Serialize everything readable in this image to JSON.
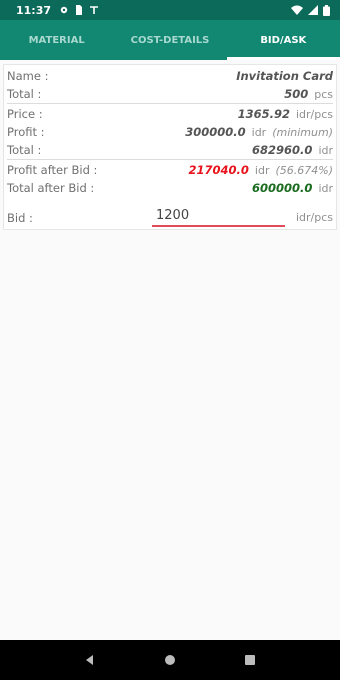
{
  "status": {
    "time": "11:37",
    "left_icons": [
      "gear-icon",
      "sim-card-icon",
      "signal-settings-icon"
    ],
    "right_icons": [
      "wifi-icon",
      "cell-signal-icon",
      "battery-icon"
    ]
  },
  "tabs": [
    {
      "label": "MATERIAL",
      "active": false
    },
    {
      "label": "COST-DETAILS",
      "active": false
    },
    {
      "label": "BID/ASK",
      "active": true
    }
  ],
  "details": {
    "name_label": "Name :",
    "name_value": "Invitation Card",
    "total_label": "Total :",
    "total_value": "500",
    "total_unit": "pcs",
    "price_label": "Price :",
    "price_value": "1365.92",
    "price_unit": "idr/pcs",
    "profit_label": "Profit :",
    "profit_value": "300000.0",
    "profit_unit": "idr",
    "profit_note": "(minimum)",
    "total2_label": "Total :",
    "total2_value": "682960.0",
    "total2_unit": "idr",
    "profit_after_bid_label": "Profit after Bid :",
    "profit_after_bid_value": "217040.0",
    "profit_after_bid_unit": "idr",
    "profit_after_bid_pct": "(56.674%)",
    "total_after_bid_label": "Total after Bid :",
    "total_after_bid_value": "600000.0",
    "total_after_bid_unit": "idr",
    "bid_label": "Bid :",
    "bid_value": "1200",
    "bid_unit": "idr/pcs"
  },
  "colors": {
    "header": "#128873",
    "statusbar": "#0b6a5a",
    "profit_after_bid": "#e8131c",
    "total_after_bid": "#1a6b1e",
    "input_underline": "#e24b5c"
  },
  "nav": [
    "back-icon",
    "home-icon",
    "recents-icon"
  ]
}
